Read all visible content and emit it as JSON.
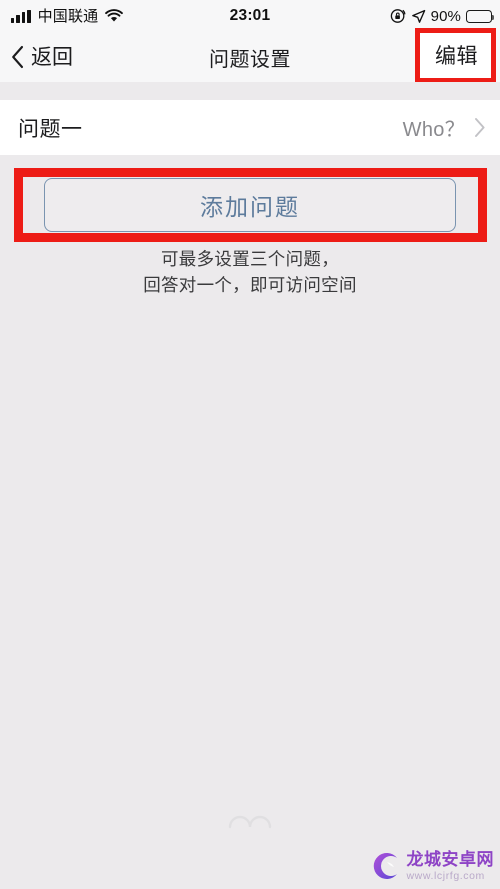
{
  "status_bar": {
    "carrier": "中国联通",
    "time": "23:01",
    "battery_percent": "90%",
    "icons": {
      "signal": "signal-bars-icon",
      "wifi": "wifi-icon",
      "rotation_lock": "rotation-lock-icon",
      "location": "location-arrow-icon",
      "battery": "battery-icon"
    }
  },
  "nav_bar": {
    "back_label": "返回",
    "title": "问题设置",
    "edit_label": "编辑"
  },
  "question_row": {
    "label": "问题一",
    "value": "Who？"
  },
  "add_button": {
    "label": "添加问题"
  },
  "hint": {
    "line1": "可最多设置三个问题，",
    "line2": "回答对一个，即可访问空间"
  },
  "watermark": {
    "title": "龙城安卓网",
    "url": "www.lcjrfg.com"
  },
  "colors": {
    "highlight_red": "#ED1C16",
    "button_blue_text": "#5D7B9C",
    "button_border_blue": "#7A94B0",
    "page_background": "#ECEAEC",
    "bar_background": "#F7F7F8",
    "row_background": "#FFFFFF",
    "value_gray": "#8A8A8E",
    "watermark_purple": "#8E44C6"
  }
}
